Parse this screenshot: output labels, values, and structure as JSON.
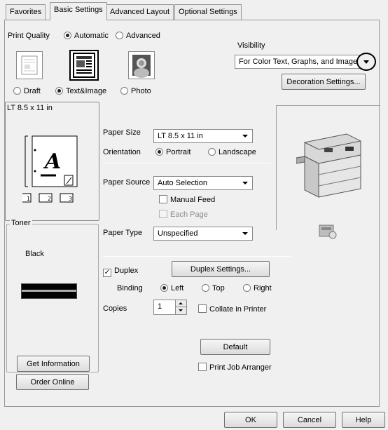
{
  "tabs": [
    "Favorites",
    "Basic Settings",
    "Advanced Layout",
    "Optional Settings"
  ],
  "print_quality": {
    "label": "Print Quality",
    "options": [
      "Automatic",
      "Advanced"
    ],
    "selected": "Automatic",
    "modes": [
      "Draft",
      "Text&Image",
      "Photo"
    ],
    "selected_mode": "Text&Image"
  },
  "visibility": {
    "label": "Visibility",
    "value": "For Color Text, Graphs, and Image",
    "decoration_button": "Decoration Settings..."
  },
  "preview": {
    "paper_label": "LT 8.5 x 11 in",
    "letter": "A"
  },
  "toner": {
    "legend": "Toner",
    "color": "Black",
    "get_info_button": "Get Information",
    "order_button": "Order Online"
  },
  "paper": {
    "size_label": "Paper Size",
    "size_value": "LT 8.5 x 11 in",
    "orientation_label": "Orientation",
    "orientation_options": [
      "Portrait",
      "Landscape"
    ],
    "orientation_selected": "Portrait",
    "source_label": "Paper Source",
    "source_value": "Auto Selection",
    "manual_feed": "Manual Feed",
    "each_page": "Each Page",
    "type_label": "Paper Type",
    "type_value": "Unspecified"
  },
  "duplex": {
    "label": "Duplex",
    "checked": true,
    "settings_button": "Duplex Settings...",
    "binding_label": "Binding",
    "binding_options": [
      "Left",
      "Top",
      "Right"
    ],
    "binding_selected": "Left"
  },
  "copies": {
    "label": "Copies",
    "value": "1",
    "collate": "Collate in Printer"
  },
  "default_button": "Default",
  "print_job_arranger": "Print Job Arranger",
  "footer": {
    "ok": "OK",
    "cancel": "Cancel",
    "help": "Help"
  }
}
